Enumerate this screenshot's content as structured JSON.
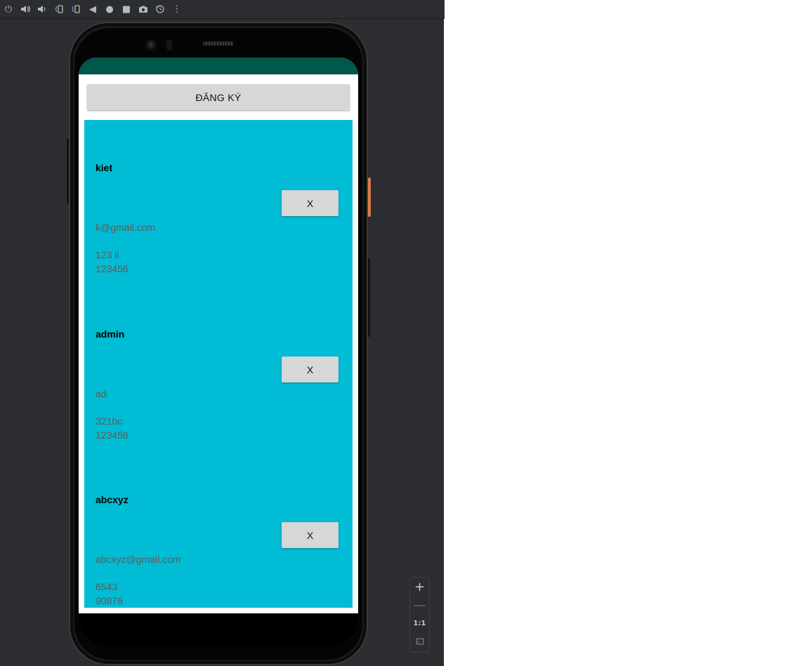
{
  "toolbar": {
    "icons": [
      "power-icon",
      "volume-up-icon",
      "volume-down-icon",
      "rotate-left-icon",
      "rotate-right-icon",
      "back-icon",
      "home-icon",
      "overview-icon",
      "camera-icon",
      "snapshot-icon",
      "more-icon"
    ],
    "glyphs": {
      "power": "⏻",
      "volume_up": "🔊",
      "volume_down": "🔉",
      "back": "◀",
      "home": "●",
      "overview": "■",
      "more": "⋮"
    }
  },
  "app": {
    "register_label": "ĐĂNG KÝ",
    "status_bar_color": "#00574b",
    "list_background": "#00bcd4"
  },
  "users": [
    {
      "name": "kiet",
      "delete_label": "X",
      "email": "k@gmail.com",
      "address": "123 li",
      "phone": "123456"
    },
    {
      "name": "admin",
      "delete_label": "X",
      "email": "ad",
      "address": "321bc",
      "phone": "123456"
    },
    {
      "name": "abcxyz",
      "delete_label": "X",
      "email": "abcxyz@gmail.com",
      "address": "6543",
      "phone": "90876"
    }
  ],
  "zoom": {
    "plus": "+",
    "minus": "—",
    "one_to_one": "1:1"
  }
}
